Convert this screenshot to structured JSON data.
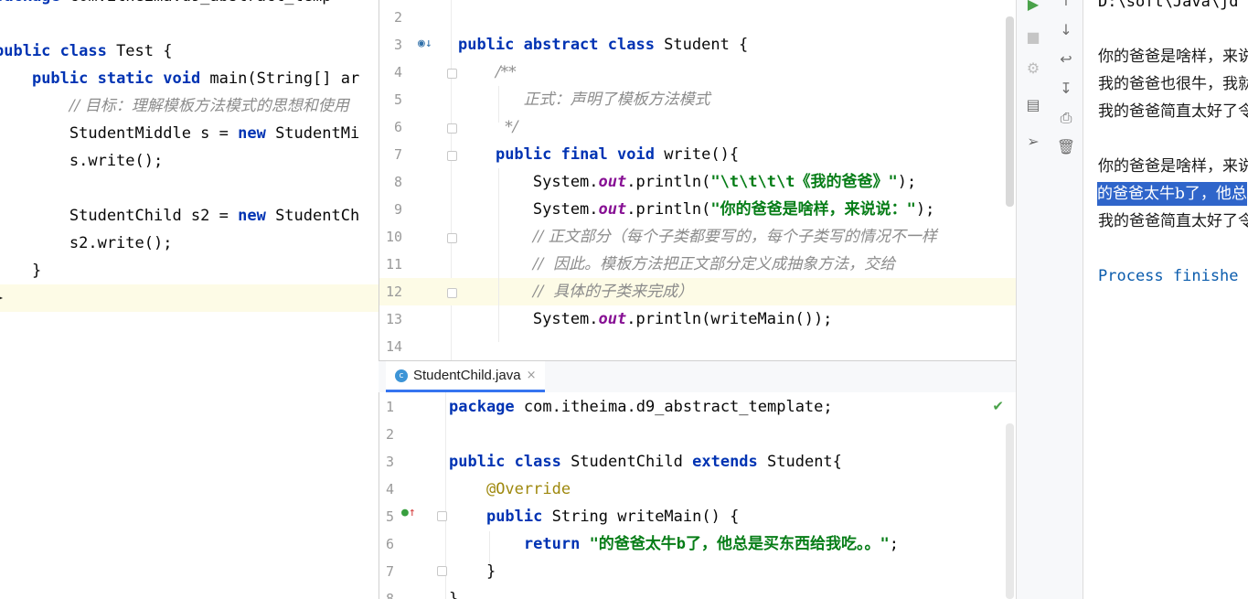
{
  "left_editor": {
    "lines": [
      {
        "segs": [
          {
            "c": "kw",
            "t": "package"
          },
          {
            "c": "",
            "t": " com.itheima.d9_abstract_temp"
          }
        ]
      },
      {
        "segs": []
      },
      {
        "segs": [
          {
            "c": "kw",
            "t": "public class"
          },
          {
            "c": "",
            "t": " Test {"
          }
        ]
      },
      {
        "segs": [
          {
            "c": "",
            "t": "    "
          },
          {
            "c": "kw",
            "t": "public static void"
          },
          {
            "c": "",
            "t": " main(String[] ar"
          }
        ]
      },
      {
        "segs": [
          {
            "c": "",
            "t": "        "
          },
          {
            "c": "cmt",
            "t": "// 目标：理解模板方法模式的思想和使用"
          }
        ]
      },
      {
        "segs": [
          {
            "c": "",
            "t": "        StudentMiddle s = "
          },
          {
            "c": "kw",
            "t": "new"
          },
          {
            "c": "",
            "t": " StudentMi"
          }
        ]
      },
      {
        "segs": [
          {
            "c": "",
            "t": "        s.write();"
          }
        ]
      },
      {
        "segs": []
      },
      {
        "segs": [
          {
            "c": "",
            "t": "        StudentChild s2 = "
          },
          {
            "c": "kw",
            "t": "new"
          },
          {
            "c": "",
            "t": " StudentCh"
          }
        ]
      },
      {
        "segs": [
          {
            "c": "",
            "t": "        s2.write();"
          }
        ]
      },
      {
        "segs": [
          {
            "c": "",
            "t": "    }"
          }
        ]
      },
      {
        "segs": [
          {
            "c": "",
            "t": "}"
          }
        ]
      }
    ]
  },
  "top_editor": {
    "lines": [
      {
        "num": "2",
        "segs": []
      },
      {
        "num": "3",
        "segs": [
          {
            "c": "kw",
            "t": "public abstract class"
          },
          {
            "c": "",
            "t": " Student {"
          }
        ]
      },
      {
        "num": "4",
        "segs": [
          {
            "c": "",
            "t": "    "
          },
          {
            "c": "cmt",
            "t": "/**"
          }
        ]
      },
      {
        "num": "5",
        "segs": [
          {
            "c": "",
            "t": "       "
          },
          {
            "c": "cmt",
            "t": "正式：声明了模板方法模式"
          }
        ]
      },
      {
        "num": "6",
        "segs": [
          {
            "c": "",
            "t": "     "
          },
          {
            "c": "cmt",
            "t": "*/"
          }
        ]
      },
      {
        "num": "7",
        "segs": [
          {
            "c": "",
            "t": "    "
          },
          {
            "c": "kw",
            "t": "public final void"
          },
          {
            "c": "",
            "t": " write(){"
          }
        ]
      },
      {
        "num": "8",
        "segs": [
          {
            "c": "",
            "t": "        System."
          },
          {
            "c": "fld",
            "t": "out"
          },
          {
            "c": "",
            "t": ".println("
          },
          {
            "c": "str",
            "t": "\"\\t\\t\\t\\t《我的爸爸》\""
          },
          {
            "c": "",
            "t": ");"
          }
        ]
      },
      {
        "num": "9",
        "segs": [
          {
            "c": "",
            "t": "        System."
          },
          {
            "c": "fld",
            "t": "out"
          },
          {
            "c": "",
            "t": ".println("
          },
          {
            "c": "str",
            "t": "\"你的爸爸是啥样，来说说：\""
          },
          {
            "c": "",
            "t": ");"
          }
        ]
      },
      {
        "num": "10",
        "segs": [
          {
            "c": "",
            "t": "        "
          },
          {
            "c": "cmt",
            "t": "// 正文部分（每个子类都要写的，每个子类写的情况不一样"
          }
        ]
      },
      {
        "num": "11",
        "segs": [
          {
            "c": "",
            "t": "        "
          },
          {
            "c": "cmt",
            "t": "//  因此。模板方法把正文部分定义成抽象方法，交给"
          }
        ]
      },
      {
        "num": "12",
        "segs": [
          {
            "c": "",
            "t": "        "
          },
          {
            "c": "cmt",
            "t": "//  具体的子类来完成）"
          }
        ]
      },
      {
        "num": "13",
        "segs": [
          {
            "c": "",
            "t": "        System."
          },
          {
            "c": "fld",
            "t": "out"
          },
          {
            "c": "",
            "t": ".println(writeMain());"
          }
        ]
      },
      {
        "num": "14",
        "segs": []
      }
    ]
  },
  "tab": {
    "file_name": "StudentChild.java",
    "close": "×"
  },
  "bottom_editor": {
    "lines": [
      {
        "num": "1",
        "segs": [
          {
            "c": "kw",
            "t": "package"
          },
          {
            "c": "",
            "t": " com.itheima.d9_abstract_template;"
          }
        ]
      },
      {
        "num": "2",
        "segs": []
      },
      {
        "num": "3",
        "segs": [
          {
            "c": "kw",
            "t": "public class"
          },
          {
            "c": "",
            "t": " StudentChild "
          },
          {
            "c": "kw",
            "t": "extends"
          },
          {
            "c": "",
            "t": " Student{"
          }
        ]
      },
      {
        "num": "4",
        "segs": [
          {
            "c": "",
            "t": "    "
          },
          {
            "c": "ann",
            "t": "@Override"
          }
        ]
      },
      {
        "num": "5",
        "segs": [
          {
            "c": "",
            "t": "    "
          },
          {
            "c": "kw",
            "t": "public"
          },
          {
            "c": "",
            "t": " String writeMain() {"
          }
        ]
      },
      {
        "num": "6",
        "segs": [
          {
            "c": "",
            "t": "        "
          },
          {
            "c": "kw",
            "t": "return"
          },
          {
            "c": "",
            "t": " "
          },
          {
            "c": "str",
            "t": "\"的爸爸太牛b了，他总是买东西给我吃。。\""
          },
          {
            "c": "",
            "t": ";"
          }
        ]
      },
      {
        "num": "7",
        "segs": [
          {
            "c": "",
            "t": "    }"
          }
        ]
      },
      {
        "num": "8",
        "segs": [
          {
            "c": "",
            "t": "}"
          }
        ]
      }
    ]
  },
  "console": {
    "lines": [
      {
        "text": "D:\\soft\\Java\\jd",
        "style": "mono"
      },
      {
        "text": "",
        "style": ""
      },
      {
        "text": "你的爸爸是啥样，来说",
        "style": "cn"
      },
      {
        "text": "我的爸爸也很牛，我就",
        "style": "cn"
      },
      {
        "text": "我的爸爸简直太好了令",
        "style": "cn"
      },
      {
        "text": "",
        "style": ""
      },
      {
        "text": "你的爸爸是啥样，来说",
        "style": "cn"
      },
      {
        "text": "的爸爸太牛b了，他总",
        "style": "sel"
      },
      {
        "text": "我的爸爸简直太好了令",
        "style": "cn"
      },
      {
        "text": "",
        "style": ""
      },
      {
        "text": "Process finishe",
        "style": "proc"
      }
    ]
  },
  "tool_icons": [
    "run-icon",
    "stop-icon",
    "debug-icon",
    "layout-icon",
    "pin-icon"
  ],
  "console_icons": [
    "up-arrow-icon",
    "down-arrow-icon",
    "soft-wrap-icon",
    "scroll-end-icon",
    "print-icon",
    "trash-icon"
  ],
  "colors": {
    "keyword": "#0033b3",
    "string": "#067d17",
    "comment": "#8c8c8c",
    "selection": "#2f65ca",
    "line_highlight": "#fdfbe6"
  }
}
